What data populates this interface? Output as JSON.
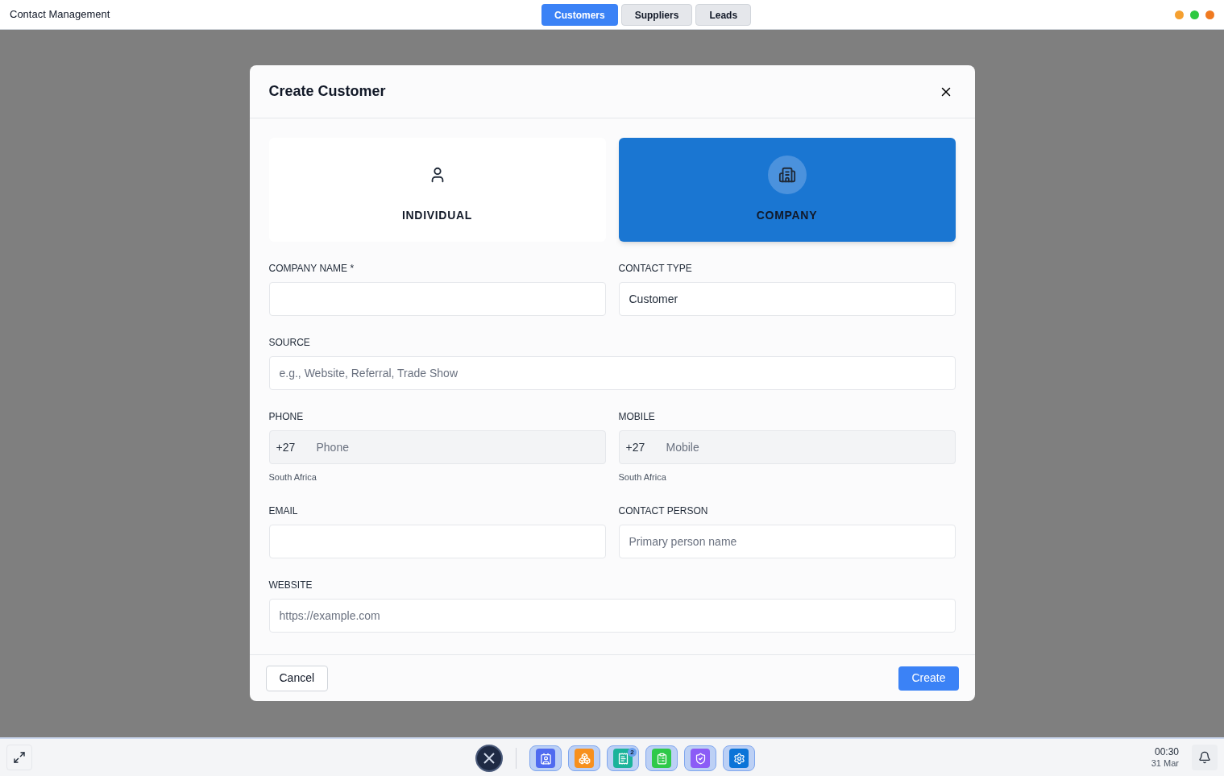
{
  "window": {
    "title": "Contact Management",
    "dots": [
      {
        "color": "#f5a030"
      },
      {
        "color": "#2ec940"
      },
      {
        "color": "#f07a20"
      }
    ]
  },
  "tabs": [
    {
      "label": "Customers",
      "selected": true
    },
    {
      "label": "Suppliers",
      "selected": false
    },
    {
      "label": "Leads",
      "selected": false
    }
  ],
  "modal": {
    "title": "Create Customer",
    "types": [
      {
        "label": "INDIVIDUAL",
        "kind": "person",
        "selected": false
      },
      {
        "label": "COMPANY",
        "kind": "building",
        "selected": true
      }
    ],
    "rows": [
      [
        {
          "label": "COMPANY NAME *",
          "kind": "text"
        },
        {
          "label": "CONTACT TYPE",
          "kind": "text",
          "value": "Customer"
        }
      ],
      [
        {
          "label": "SOURCE",
          "kind": "text",
          "placeholder": "e.g., Website, Referral, Trade Show"
        }
      ],
      [
        {
          "label": "PHONE",
          "kind": "phone",
          "prefix": "+27",
          "placeholder": "Phone",
          "hint": "South Africa"
        },
        {
          "label": "MOBILE",
          "kind": "phone",
          "prefix": "+27",
          "placeholder": "Mobile",
          "hint": "South Africa"
        }
      ],
      [
        {
          "label": "EMAIL",
          "kind": "text"
        },
        {
          "label": "CONTACT PERSON",
          "kind": "text",
          "placeholder": "Primary person name"
        }
      ],
      [
        {
          "label": "WEBSITE",
          "kind": "text",
          "placeholder": "https://example.com"
        }
      ]
    ],
    "cancel": "Cancel",
    "submit": "Create"
  },
  "taskbar": {
    "apps": [
      {
        "kind": "contacts",
        "color": "#4f6bf0"
      },
      {
        "kind": "boxes",
        "color": "#f7901e"
      },
      {
        "kind": "invoice",
        "color": "#1bb39a",
        "badge": "2"
      },
      {
        "kind": "clipboard",
        "color": "#2ec94a"
      },
      {
        "kind": "shield",
        "color": "#8b5cf6"
      },
      {
        "kind": "gear",
        "color": "#0b74d8"
      }
    ],
    "time": "00:30",
    "date": "31 Mar"
  }
}
